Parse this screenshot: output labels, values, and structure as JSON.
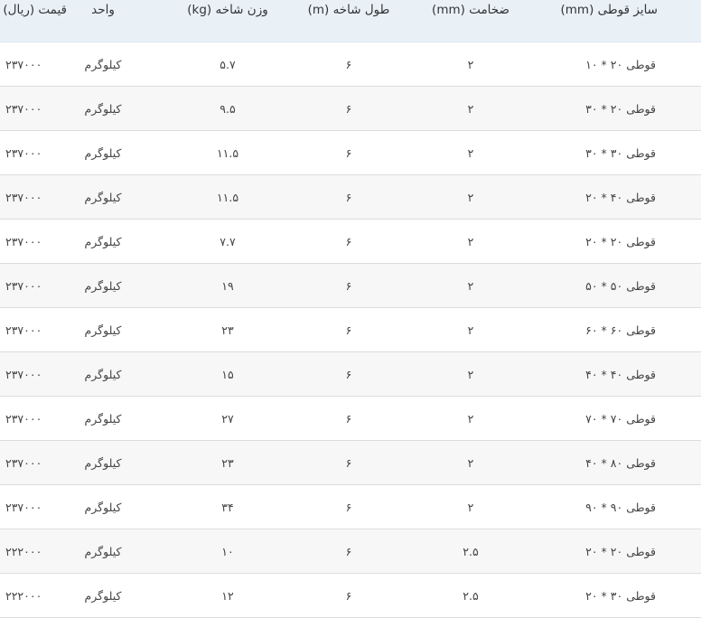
{
  "table": {
    "headers": {
      "size": "سایز قوطی (mm)",
      "thickness": "ضخامت (mm)",
      "length": "طول شاخه (m)",
      "weight": "وزن شاخه (kg)",
      "unit": "واحد",
      "price": "قیمت (ریال)"
    },
    "rows": [
      {
        "size": "قوطی ۲۰ * ۱۰",
        "thickness": "۲",
        "length": "۶",
        "weight": "۵.۷",
        "unit": "کیلوگرم",
        "price": "۲۳۷۰۰۰"
      },
      {
        "size": "قوطی ۲۰ * ۳۰",
        "thickness": "۲",
        "length": "۶",
        "weight": "۹.۵",
        "unit": "کیلوگرم",
        "price": "۲۳۷۰۰۰"
      },
      {
        "size": "قوطی ۳۰ * ۳۰",
        "thickness": "۲",
        "length": "۶",
        "weight": "۱۱.۵",
        "unit": "کیلوگرم",
        "price": "۲۳۷۰۰۰"
      },
      {
        "size": "قوطی ۴۰ * ۲۰",
        "thickness": "۲",
        "length": "۶",
        "weight": "۱۱.۵",
        "unit": "کیلوگرم",
        "price": "۲۳۷۰۰۰"
      },
      {
        "size": "قوطی ۲۰ * ۲۰",
        "thickness": "۲",
        "length": "۶",
        "weight": "۷.۷",
        "unit": "کیلوگرم",
        "price": "۲۳۷۰۰۰"
      },
      {
        "size": "قوطی ۵۰ * ۵۰",
        "thickness": "۲",
        "length": "۶",
        "weight": "۱۹",
        "unit": "کیلوگرم",
        "price": "۲۳۷۰۰۰"
      },
      {
        "size": "قوطی ۶۰ * ۶۰",
        "thickness": "۲",
        "length": "۶",
        "weight": "۲۳",
        "unit": "کیلوگرم",
        "price": "۲۳۷۰۰۰"
      },
      {
        "size": "قوطی ۴۰ * ۴۰",
        "thickness": "۲",
        "length": "۶",
        "weight": "۱۵",
        "unit": "کیلوگرم",
        "price": "۲۳۷۰۰۰"
      },
      {
        "size": "قوطی ۷۰ * ۷۰",
        "thickness": "۲",
        "length": "۶",
        "weight": "۲۷",
        "unit": "کیلوگرم",
        "price": "۲۳۷۰۰۰"
      },
      {
        "size": "قوطی ۸۰ * ۴۰",
        "thickness": "۲",
        "length": "۶",
        "weight": "۲۳",
        "unit": "کیلوگرم",
        "price": "۲۳۷۰۰۰"
      },
      {
        "size": "قوطی ۹۰ * ۹۰",
        "thickness": "۲",
        "length": "۶",
        "weight": "۳۴",
        "unit": "کیلوگرم",
        "price": "۲۳۷۰۰۰"
      },
      {
        "size": "قوطی ۲۰ * ۲۰",
        "thickness": "۲.۵",
        "length": "۶",
        "weight": "۱۰",
        "unit": "کیلوگرم",
        "price": "۲۲۲۰۰۰"
      },
      {
        "size": "قوطی ۳۰ * ۲۰",
        "thickness": "۲.۵",
        "length": "۶",
        "weight": "۱۲",
        "unit": "کیلوگرم",
        "price": "۲۲۲۰۰۰"
      }
    ]
  }
}
